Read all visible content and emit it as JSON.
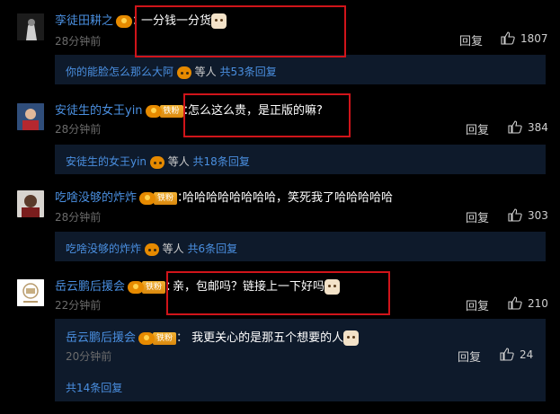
{
  "comments": [
    {
      "user": "孪徒田耕之",
      "text": "一分钱一分货",
      "time": "28分钟前",
      "reply_label": "回复",
      "likes": "1807",
      "sub_user": "你的能脸怎么那么大阿",
      "sub_text": "等人",
      "sub_more": "共53条回复"
    },
    {
      "user": "安徒生的女王yin",
      "fan_badge": "铁粉",
      "text": "怎么这么贵，是正版的嘛?",
      "time": "28分钟前",
      "reply_label": "回复",
      "likes": "384",
      "sub_user": "安徒生的女王yin",
      "sub_text": "等人",
      "sub_more": "共18条回复"
    },
    {
      "user": "吃啥没够的炸炸",
      "fan_badge": "铁粉",
      "text": "哈哈哈哈哈哈哈哈，笑死我了哈哈哈哈哈",
      "time": "28分钟前",
      "reply_label": "回复",
      "likes": "303",
      "sub_user": "吃啥没够的炸炸",
      "sub_text": "等人",
      "sub_more": "共6条回复"
    },
    {
      "user": "岳云鹏后援会",
      "fan_badge": "铁粉",
      "text": "亲，包邮吗？链接上一下好吗",
      "time": "22分钟前",
      "reply_label": "回复",
      "likes": "210",
      "sub_reply": {
        "user": "岳云鹏后援会",
        "fan_badge": "铁粉",
        "text": "我更关心的是那五个想要的人",
        "time": "20分钟前",
        "reply_label": "回复",
        "likes": "24"
      },
      "sub_more": "共14条回复"
    }
  ],
  "colors": {
    "background": "#000000",
    "username": "#4a8fe0",
    "sub_panel": "#0e1a2b",
    "highlight_box": "#d0141a"
  },
  "icons": [
    "avatar",
    "vip-badge-icon",
    "thumbs-up-icon",
    "emoji-icon"
  ]
}
